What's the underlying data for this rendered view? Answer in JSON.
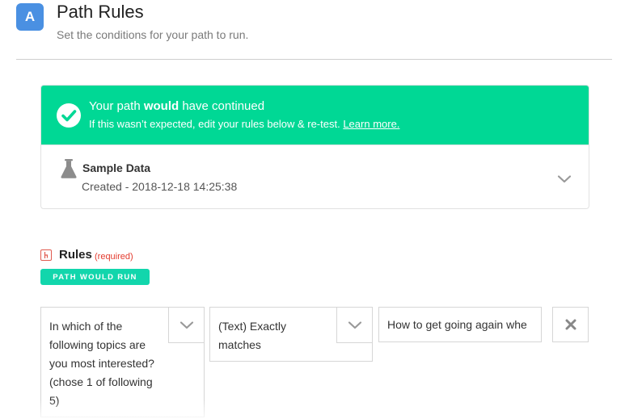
{
  "header": {
    "step_letter": "A",
    "title": "Path Rules",
    "subtitle": "Set the conditions for your path to run."
  },
  "status": {
    "headline_prefix": "Your path ",
    "headline_bold": "would",
    "headline_suffix": " have continued",
    "help_text": "If this wasn’t expected, edit your rules below & re-test.",
    "learn_more_label": "Learn more.",
    "color": "#00d895"
  },
  "sample_data": {
    "title": "Sample Data",
    "created": "Created - 2018-12-18 14:25:38"
  },
  "rules": {
    "label": "Rules",
    "required_label": "(required)",
    "run_badge": "PATH WOULD RUN",
    "badge_color": "#12d6ac",
    "condition": {
      "field": "In which of the following topics are you most interested? (chose 1 of following 5)",
      "operator": "(Text) Exactly matches",
      "value": "How to get going again whe"
    }
  },
  "icons": {
    "status": "check-circle-icon",
    "sample": "flask-icon",
    "expand": "chevron-down-icon",
    "remove": "close-icon",
    "rules": "filter-icon"
  }
}
